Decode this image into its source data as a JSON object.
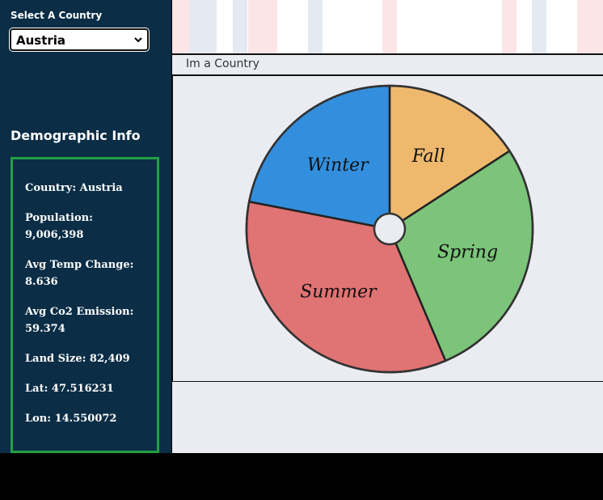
{
  "sidebar": {
    "select_label": "Select A Country",
    "selected_country": "Austria",
    "demographic_heading": "Demographic Info",
    "info": [
      "Country: Austria",
      "Population: 9,006,398",
      "Avg Temp Change: 8.636",
      "Avg Co2 Emission: 59.374",
      "Land Size: 82,409",
      "Lat: 47.516231",
      "Lon: 14.550072"
    ]
  },
  "main": {
    "country_title": "Im a Country"
  },
  "chart_data": {
    "type": "pie",
    "title": "",
    "slices": [
      {
        "label": "Fall",
        "value": 57,
        "color": "#efb96d"
      },
      {
        "label": "Spring",
        "value": 100,
        "color": "#7bc47a"
      },
      {
        "label": "Summer",
        "value": 124,
        "color": "#e07373"
      },
      {
        "label": "Winter",
        "value": 79,
        "color": "#338fde"
      }
    ],
    "start": "top",
    "direction": "clockwise",
    "donut_hole": true
  },
  "colors": {
    "sidebar_bg": "#0b2d46",
    "info_border": "#22a045",
    "main_bg": "#eaecf1",
    "stripe_red": "#fde5e7",
    "stripe_blue": "#e4e9f2"
  }
}
